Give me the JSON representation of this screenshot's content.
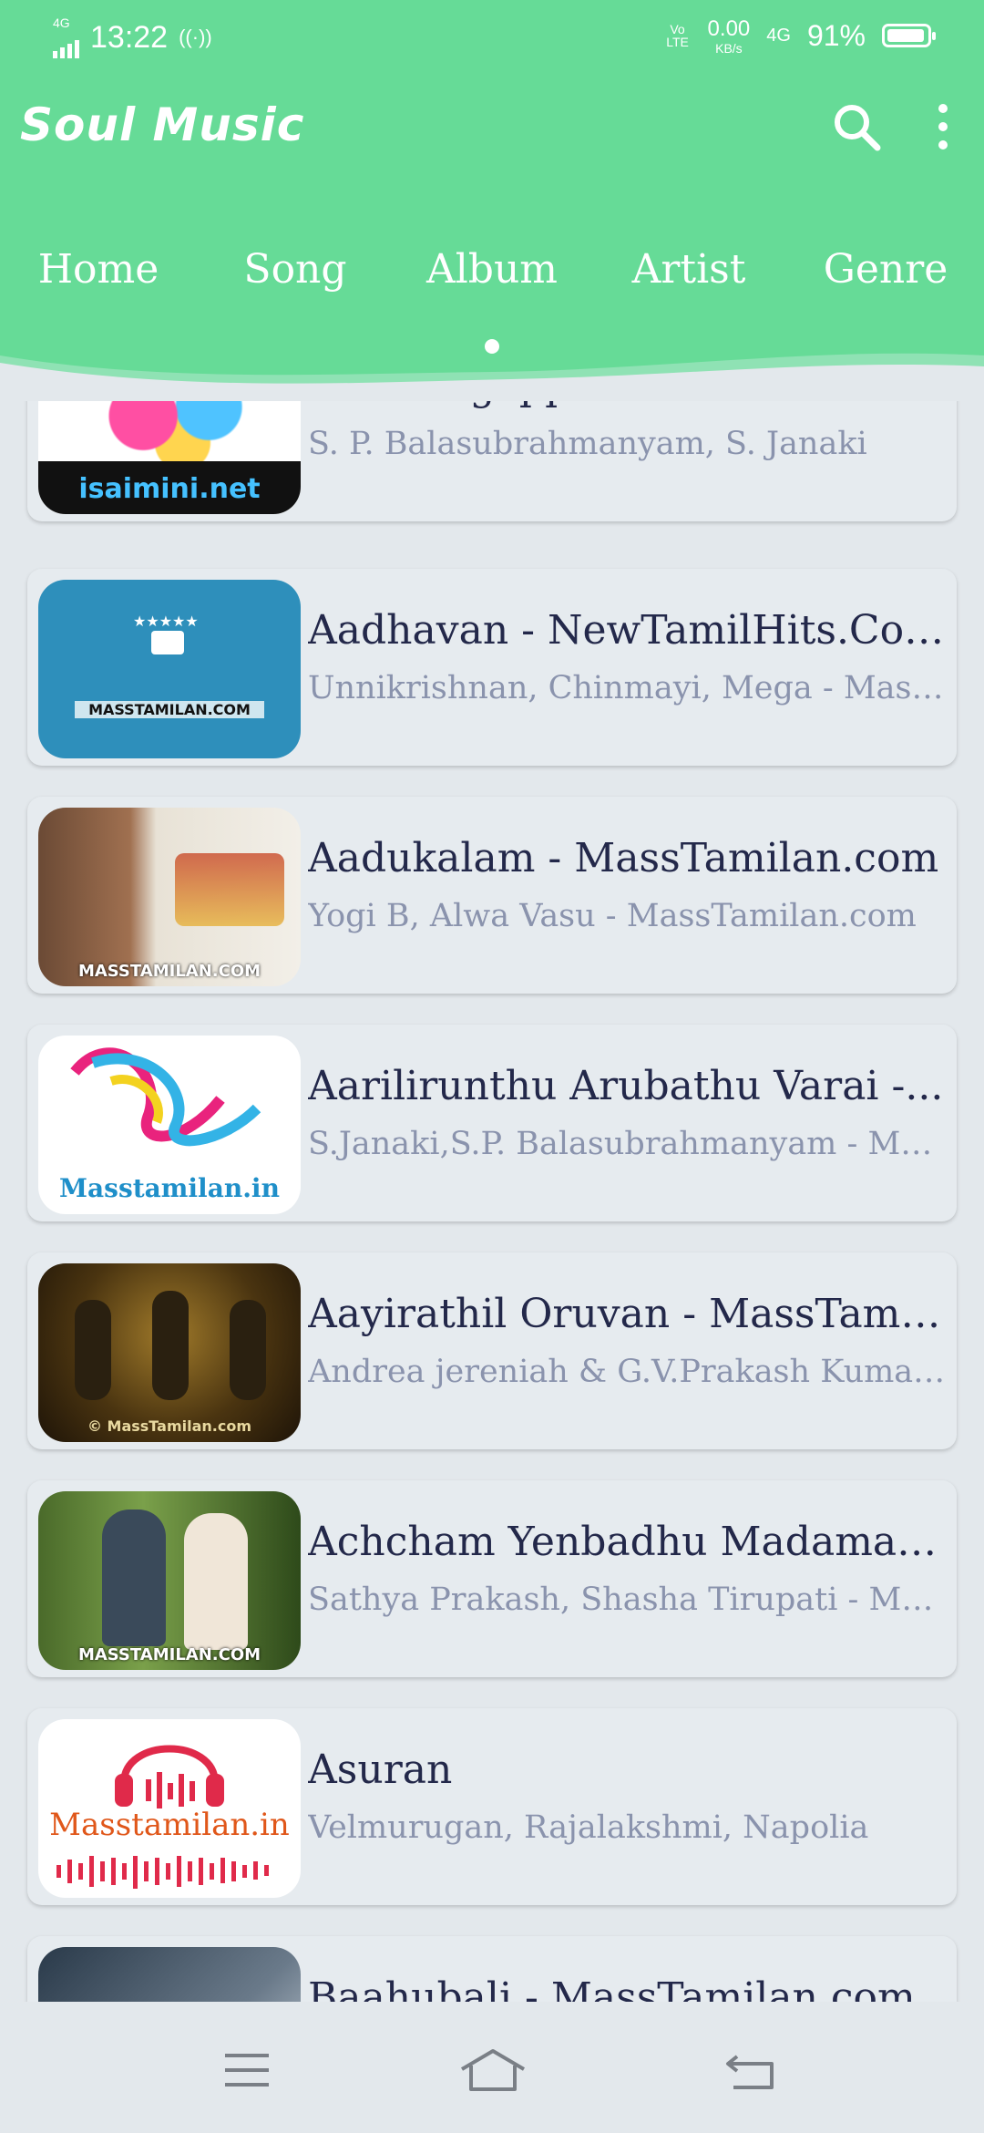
{
  "status": {
    "network_left": "4G",
    "time": "13:22",
    "volte": "Vo LTE",
    "speed": "0.00",
    "speed_unit": "KB/s",
    "network_right": "4G",
    "battery": "91%"
  },
  "app": {
    "title": "Soul Music",
    "search_icon": "search-icon",
    "more_icon": "more-vert-icon"
  },
  "tabs": [
    {
      "label": "Home"
    },
    {
      "label": "Song"
    },
    {
      "label": "Album"
    },
    {
      "label": "Artist"
    },
    {
      "label": "Genre"
    }
  ],
  "selected_tab": "Album",
  "albums": [
    {
      "title": "Naan Sigappu Manithan",
      "artists": "S. P. Balasubrahmanyam, S. Janaki",
      "thumb_text": "isaimini.net"
    },
    {
      "title": "Aadhavan - NewTamilHits.Com™...",
      "artists": "Unnikrishnan, Chinmayi, Mega - Mass...",
      "thumb_text": "MASSTAMILAN.COM"
    },
    {
      "title": "Aadukalam - MassTamilan.com",
      "artists": "Yogi B, Alwa Vasu - MassTamilan.com",
      "thumb_text": "MASSTAMILAN.COM"
    },
    {
      "title": "Aarilirunthu Arubathu Varai -...",
      "artists": "S.Janaki,S.P. Balasubrahmanyam - Mass...",
      "thumb_text": "Masstamilan.in"
    },
    {
      "title": "Aayirathil Oruvan - MassTamila...",
      "artists": "Andrea jereniah & G.V.Prakash Kumar -...",
      "thumb_text": "© MassTamilan.com"
    },
    {
      "title": "Achcham Yenbadhu Madamaiya...",
      "artists": "Sathya Prakash, Shasha Tirupati - Mass...",
      "thumb_text": "MASSTAMILAN.COM"
    },
    {
      "title": "Asuran",
      "artists": "Velmurugan, Rajalakshmi, Napolia",
      "thumb_text": "Masstamilan.in"
    },
    {
      "title": "Baahubali - MassTamilan.com",
      "artists": "",
      "thumb_text": ""
    }
  ],
  "nav": {
    "menu_icon": "menu-icon",
    "home_icon": "home-icon",
    "back_icon": "back-icon"
  },
  "colors": {
    "header": "#66db97",
    "background": "#e3e8ec",
    "title_text": "#23284a",
    "subtitle_text": "#8a93ad"
  }
}
